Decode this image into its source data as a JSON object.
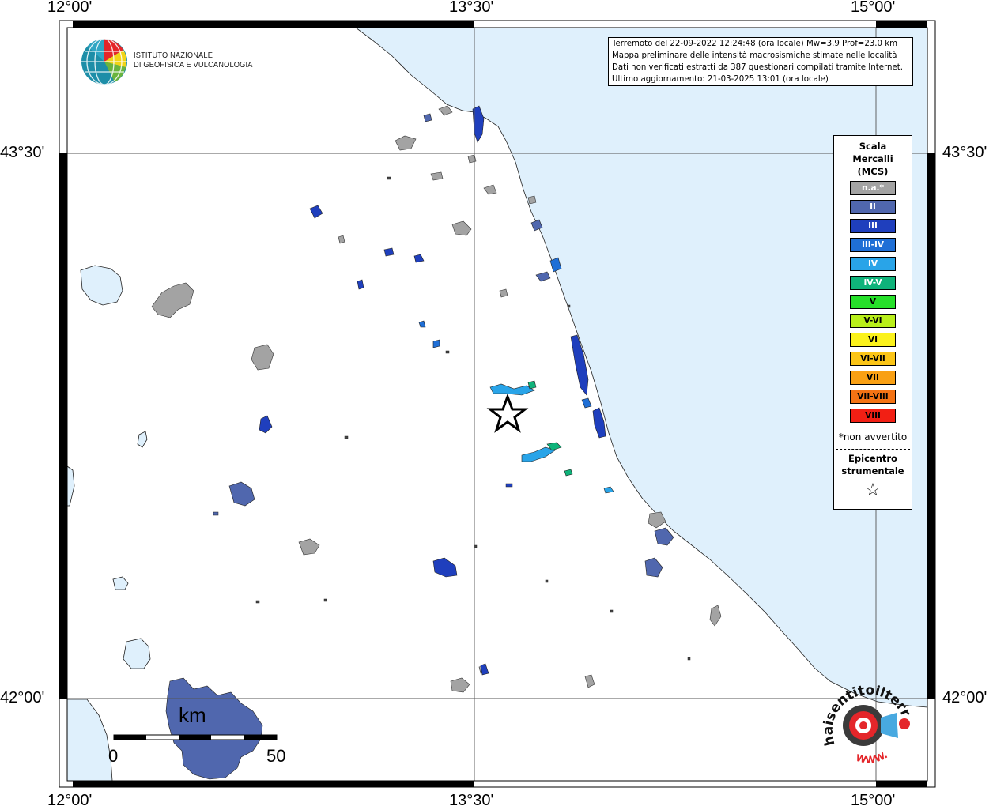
{
  "map": {
    "title_lines": [
      "Terremoto del 22-09-2022 12:24:48 (ora locale) Mw=3.9 Prof=23.0 km",
      "Mappa preliminare delle intensità macrosismiche stimate nelle località",
      "Dati non verificati estratti da 387 questionari compilati tramite Internet.",
      "Ultimo aggiornamento: 21-03-2025 13:01 (ora locale)"
    ],
    "lon_labels": {
      "left": "12°00'",
      "center": "13°30'",
      "right": "15°00'"
    },
    "lat_labels": {
      "top": "43°30'",
      "bottom": "42°00'"
    },
    "colors": {
      "sea": "#dff0fc",
      "lake": "#dff0fc",
      "land": "#ffffff",
      "na_gray": "#a0a0a0"
    }
  },
  "logo": {
    "line1": "ISTITUTO NAZIONALE",
    "line2": "DI GEOFISICA E VULCANOLOGIA"
  },
  "legend": {
    "title_lines": [
      "Scala",
      "Mercalli",
      "(MCS)"
    ],
    "items": [
      {
        "label": "n.a.*",
        "color": "#a3a3a3"
      },
      {
        "label": "II",
        "color": "#5067ae"
      },
      {
        "label": "III",
        "color": "#1f3fbd"
      },
      {
        "label": "III-IV",
        "color": "#1f6fd6"
      },
      {
        "label": "IV",
        "color": "#29a4e8"
      },
      {
        "label": "IV-V",
        "color": "#0fb37a"
      },
      {
        "label": "V",
        "color": "#26e02a"
      },
      {
        "label": "V-VI",
        "color": "#b9ef1a"
      },
      {
        "label": "VI",
        "color": "#fbf21c"
      },
      {
        "label": "VI-VII",
        "color": "#fbc517"
      },
      {
        "label": "VII",
        "color": "#f9a014"
      },
      {
        "label": "VII-VIII",
        "color": "#f47314"
      },
      {
        "label": "VIII",
        "color": "#f21f14"
      }
    ],
    "note": "*non avvertito",
    "epicenter_lines": [
      "Epicentro",
      "strumentale"
    ],
    "epicenter_symbol": "☆"
  },
  "scalebar": {
    "unit": "km",
    "min": "0",
    "max": "50"
  },
  "stamp": {
    "arc_text": "haisentitoilterremoto.it",
    "bottom_text": "WWW."
  }
}
